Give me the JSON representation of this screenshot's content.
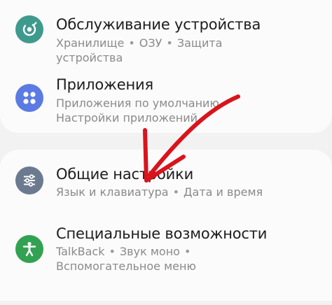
{
  "items": [
    {
      "title": "Обслуживание устройства",
      "subtitle_parts": [
        "Хранилище",
        "ОЗУ",
        "Защита устройства"
      ],
      "icon": "device-care-icon",
      "icon_color": "#3f9a8e"
    },
    {
      "title": "Приложения",
      "subtitle_parts": [
        "Приложения по умолчанию",
        "Настройки приложений"
      ],
      "icon": "apps-icon",
      "icon_color": "#5b7be3"
    },
    {
      "title": "Общие настройки",
      "subtitle_parts": [
        "Язык и клавиатура",
        "Дата и время"
      ],
      "icon": "general-management-icon",
      "icon_color": "#6b7a8f"
    },
    {
      "title": "Специальные возможности",
      "subtitle_parts": [
        "TalkBack",
        "Звук моно",
        "Вспомогательное меню"
      ],
      "icon": "accessibility-icon",
      "icon_color": "#32a252"
    }
  ],
  "annotation": {
    "arrow_color": "#d9141c"
  }
}
